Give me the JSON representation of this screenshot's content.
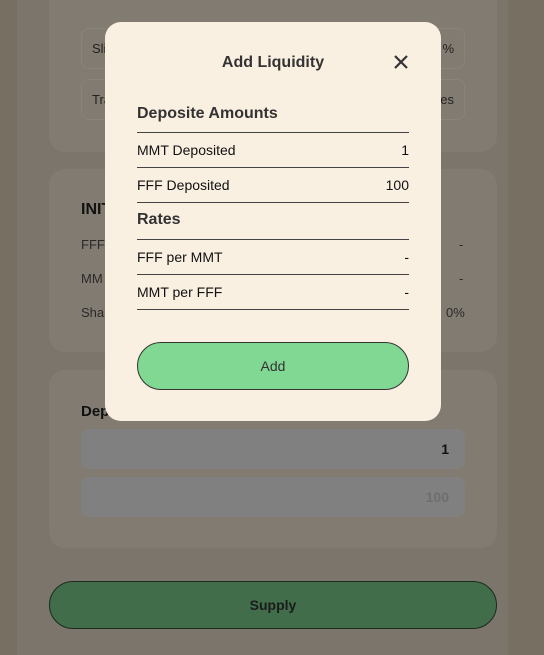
{
  "background": {
    "slippage_label": "Sli",
    "slippage_value": "%",
    "transaction_label": "Tra",
    "transaction_value": "es",
    "initial_heading": "INIT",
    "rows": [
      {
        "label": "FFF",
        "value": "-"
      },
      {
        "label": "MM",
        "value": "-"
      },
      {
        "label": "Sha",
        "value": "0%"
      }
    ],
    "deposit_heading": "Dep",
    "inputs": [
      {
        "value": "1"
      },
      {
        "value": "100"
      }
    ],
    "supply_label": "Supply"
  },
  "modal": {
    "title": "Add Liquidity",
    "close_icon": "close-icon",
    "deposit_heading": "Deposite Amounts",
    "deposits": [
      {
        "label": "MMT Deposited",
        "value": "1"
      },
      {
        "label": "FFF Deposited",
        "value": "100"
      }
    ],
    "rates_heading": "Rates",
    "rates": [
      {
        "label": "FFF per MMT",
        "value": "-"
      },
      {
        "label": "MMT per FFF",
        "value": "-"
      }
    ],
    "add_label": "Add",
    "add_color": "#81d893"
  }
}
